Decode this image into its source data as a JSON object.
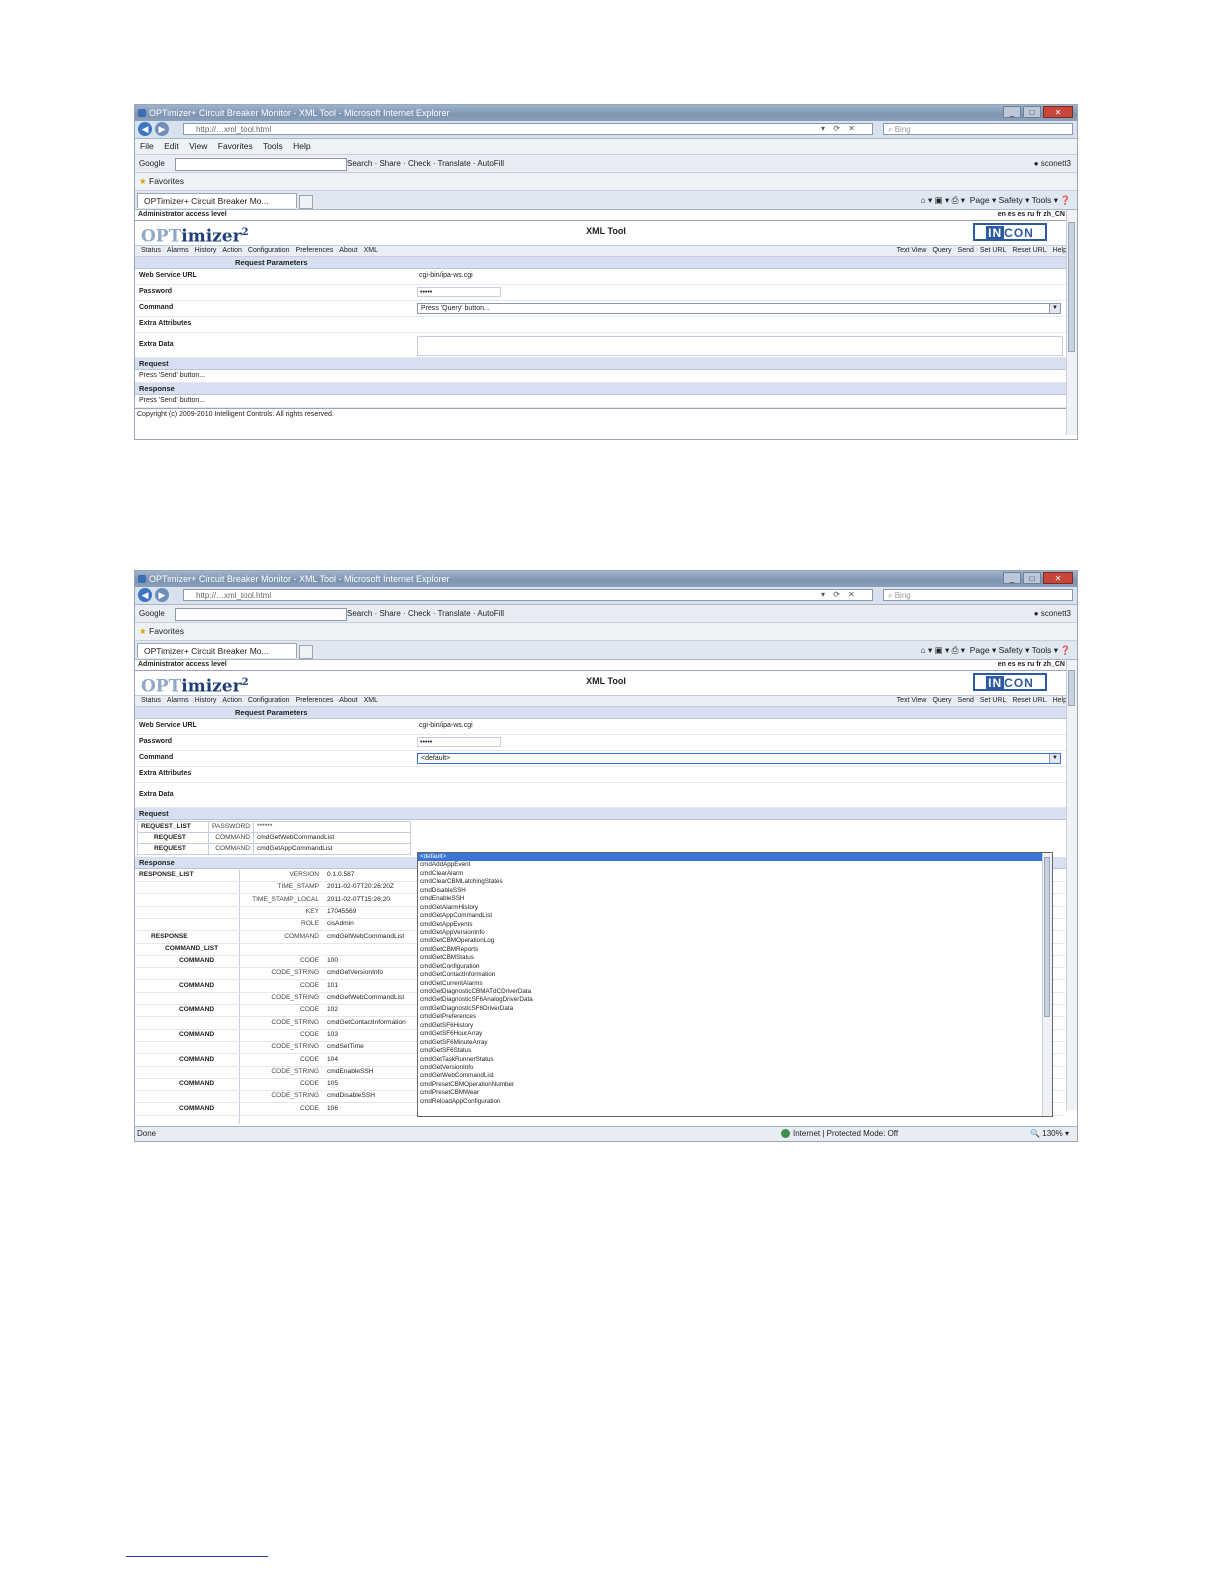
{
  "browser": {
    "window_title": "OPTimizer+ Circuit Breaker Monitor - XML Tool - Microsoft Internet Explorer",
    "url": "http://",
    "url_path": "xml_tool.html",
    "search_placeholder": "Bing",
    "menu": [
      "File",
      "Edit",
      "View",
      "Favorites",
      "Tools",
      "Help"
    ],
    "google_label": "Google",
    "google_tools": [
      "Search",
      "Share",
      "Check",
      "Translate",
      "AutoFill"
    ],
    "google_account": "sconett3",
    "favorites_label": "Favorites",
    "tab_title": "OPTimizer+ Circuit Breaker Mo...",
    "command_bar": [
      "Page",
      "Safety",
      "Tools"
    ]
  },
  "app": {
    "access_level": "Administrator access level",
    "languages": "en es es ru fr zh_CN",
    "logo_opt": "OPT",
    "logo_rest": "imizer",
    "logo_sup": "2",
    "title": "XML Tool",
    "brand_a": "IN",
    "brand_b": "CON",
    "menu_left": [
      "Status",
      "Alarms",
      "History",
      "Action",
      "Configuration",
      "Preferences",
      "About",
      "XML"
    ],
    "menu_right": [
      "Text View",
      "Query",
      "Send",
      "Set URL",
      "Reset URL",
      "Help"
    ],
    "section_request_params": "Request Parameters",
    "labels": {
      "web_service_url": "Web Service URL",
      "password": "Password",
      "command": "Command",
      "extra_attributes": "Extra Attributes",
      "extra_data": "Extra Data"
    },
    "web_service_url_value": "cgi-bin/ipa-ws.cgi",
    "password_value": "•••••",
    "section_request": "Request",
    "section_response": "Response",
    "copyright": "Copyright (c) 2009-2010 Intelligent Controls. All rights reserved."
  },
  "shot1": {
    "command_value": "Press 'Query' button...",
    "request_text": "Press 'Send' button...",
    "response_text": "Press 'Send' button..."
  },
  "shot2": {
    "command_value": "<default>",
    "dropdown_options": [
      "<default>",
      "cmdAddAppEvent",
      "cmdClearAlarm",
      "cmdClearCBMLatchingStates",
      "cmdDisableSSH",
      "cmdEnableSSH",
      "cmdGetAlarmHistory",
      "cmdGetAppCommandList",
      "cmdGetAppEvents",
      "cmdGetAppVersionInfo",
      "cmdGetCBMOperationLog",
      "cmdGetCBMReports",
      "cmdGetCBMStatus",
      "cmdGetConfiguration",
      "cmdGetContactInformation",
      "cmdGetCurrentAlarms",
      "cmdGetDiagnosticCBMATdCDriverData",
      "cmdGetDiagnosticSF6AnalogDriverData",
      "cmdGetDiagnosticSF6DriverData",
      "cmdGetPreferences",
      "cmdGetSF6History",
      "cmdGetSF6HourArray",
      "cmdGetSF6MinuteArray",
      "cmdGetSF6Status",
      "cmdGetTaskRunnerStatus",
      "cmdGetVersionInfo",
      "cmdGetWebCommandList",
      "cmdPresetCBMOperationNumber",
      "cmdPresetCBMWear",
      "cmdReloadAppConfiguration"
    ],
    "request_table": [
      {
        "node": "REQUEST_LIST",
        "attr": "PASSWORD",
        "value": "******"
      },
      {
        "node": "REQUEST",
        "attr": "COMMAND",
        "value": "cmdGetWebCommandList"
      },
      {
        "node": "REQUEST",
        "attr": "COMMAND",
        "value": "cmdGetAppCommandList"
      }
    ],
    "response_rows": [
      {
        "node": "RESPONSE_LIST",
        "attr": "VERSION",
        "value": "0.1.0.587"
      },
      {
        "node": "",
        "attr": "TIME_STAMP",
        "value": "2011-02-07T20:26:20Z"
      },
      {
        "node": "",
        "attr": "TIME_STAMP_LOCAL",
        "value": "2011-02-07T15:26:20"
      },
      {
        "node": "",
        "attr": "KEY",
        "value": "17045569"
      },
      {
        "node": "",
        "attr": "ROLE",
        "value": "cisAdmin"
      },
      {
        "node": "RESPONSE",
        "attr": "COMMAND",
        "value": "cmdGetWebCommandList"
      },
      {
        "node": "COMMAND_LIST",
        "attr": "",
        "value": ""
      },
      {
        "node": "COMMAND",
        "attr": "CODE",
        "value": "100"
      },
      {
        "node": "",
        "attr": "CODE_STRING",
        "value": "cmdGetVersionInfo"
      },
      {
        "node": "COMMAND",
        "attr": "CODE",
        "value": "101"
      },
      {
        "node": "",
        "attr": "CODE_STRING",
        "value": "cmdGetWebCommandList"
      },
      {
        "node": "COMMAND",
        "attr": "CODE",
        "value": "102"
      },
      {
        "node": "",
        "attr": "CODE_STRING",
        "value": "cmdGetContactInformation"
      },
      {
        "node": "COMMAND",
        "attr": "CODE",
        "value": "103"
      },
      {
        "node": "",
        "attr": "CODE_STRING",
        "value": "cmdSetTime"
      },
      {
        "node": "COMMAND",
        "attr": "CODE",
        "value": "104"
      },
      {
        "node": "",
        "attr": "CODE_STRING",
        "value": "cmdEnableSSH"
      },
      {
        "node": "COMMAND",
        "attr": "CODE",
        "value": "105"
      },
      {
        "node": "",
        "attr": "CODE_STRING",
        "value": "cmdDisableSSH"
      },
      {
        "node": "COMMAND",
        "attr": "CODE",
        "value": "106"
      }
    ],
    "status_left": "Done",
    "status_zone": "Internet | Protected Mode: Off",
    "status_zoom": "130%"
  }
}
